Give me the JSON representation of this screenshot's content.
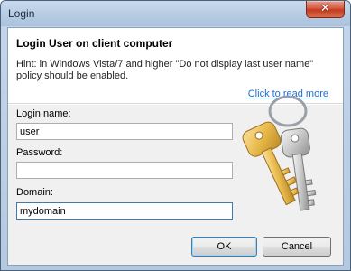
{
  "window": {
    "title": "Login",
    "close_glyph": "✕"
  },
  "header": {
    "title": "Login User on client computer",
    "hint": "Hint: in Windows Vista/7 and higher  \"Do not display last user name\" policy should be enabled.",
    "read_more_link": "Click to read more"
  },
  "form": {
    "login_label": "Login name:",
    "login_value": "user",
    "password_label": "Password:",
    "password_value": "",
    "domain_label": "Domain:",
    "domain_value": "mydomain"
  },
  "buttons": {
    "ok_label": "OK",
    "cancel_label": "Cancel"
  },
  "decor": {
    "keys_icon": "keys-icon",
    "key_gold_color": "#e8b84a",
    "key_silver_color": "#c8c8c8"
  }
}
